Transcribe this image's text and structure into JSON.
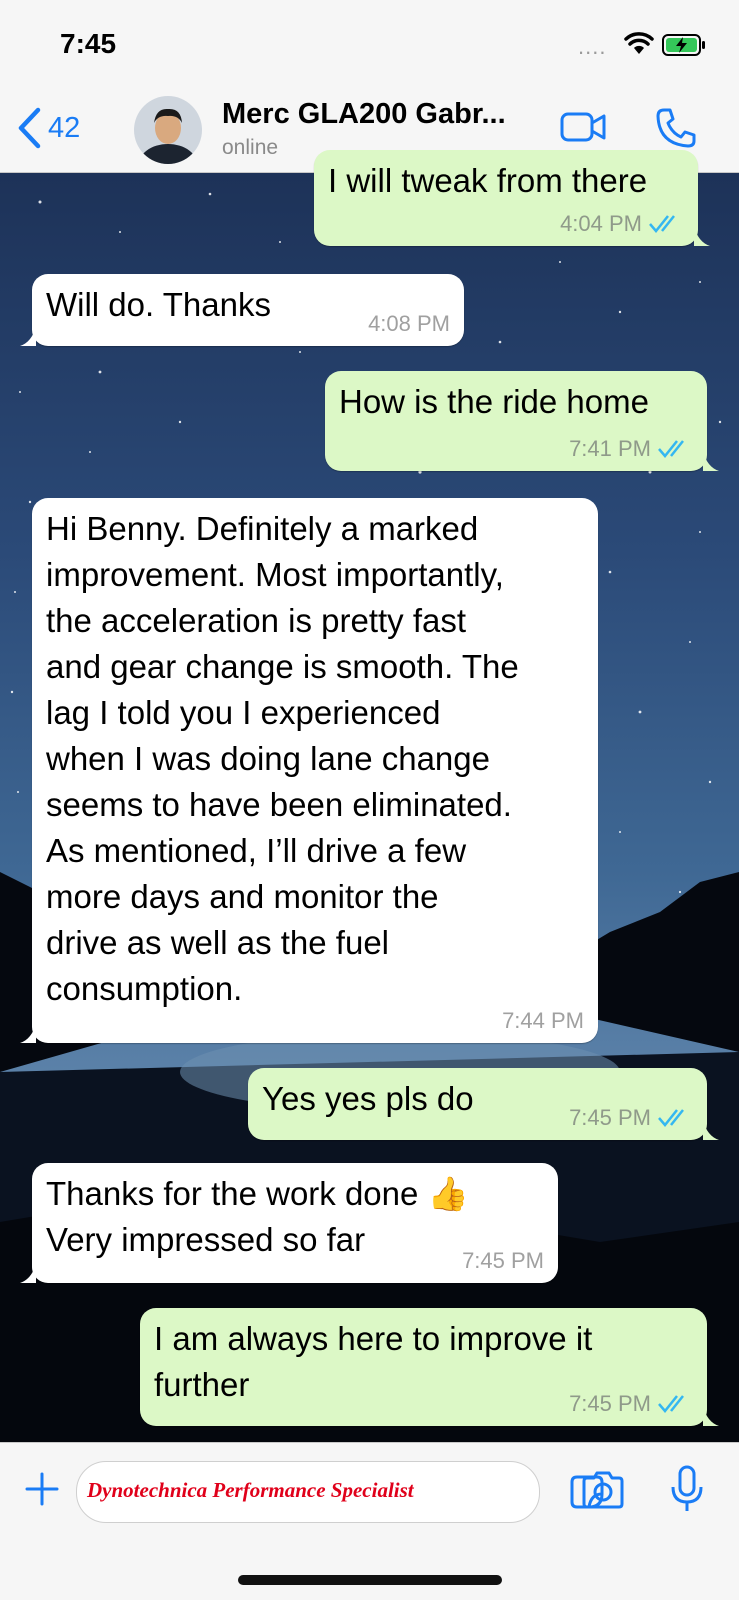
{
  "status_bar": {
    "time": "7:45",
    "signal": "....",
    "icons": [
      "wifi-icon",
      "battery-charging-icon"
    ]
  },
  "header": {
    "back_icon": "chevron-left-icon",
    "back_count": "42",
    "contact_name": "Merc GLA200 Gabr...",
    "contact_status": "online",
    "actions": [
      "video-call-icon",
      "phone-icon"
    ]
  },
  "messages": [
    {
      "direction": "outgoing",
      "text_lines": [
        "I will tweak from there"
      ],
      "time": "4:04 PM",
      "read": true
    },
    {
      "direction": "incoming",
      "text_lines": [
        "Will do. Thanks"
      ],
      "time": "4:08 PM"
    },
    {
      "direction": "outgoing",
      "text_lines": [
        "How is the ride home"
      ],
      "time": "7:41 PM",
      "read": true
    },
    {
      "direction": "incoming",
      "text_lines": [
        "Hi Benny. Definitely a marked",
        "improvement. Most importantly,",
        "the acceleration is pretty fast",
        "and gear change is smooth. The",
        "lag I told you I experienced",
        "when I was doing lane change",
        "seems to have been eliminated.",
        "As mentioned, I’ll drive a few",
        "more days and monitor the",
        "drive as well as the fuel",
        "consumption."
      ],
      "time": "7:44 PM"
    },
    {
      "direction": "outgoing",
      "text_lines": [
        "Yes yes pls do"
      ],
      "time": "7:45 PM",
      "read": true
    },
    {
      "direction": "incoming",
      "text_lines": [
        "Thanks for the work done 👍",
        "Very impressed so far"
      ],
      "time": "7:45 PM"
    },
    {
      "direction": "outgoing",
      "text_lines": [
        "I am always here to improve it",
        "further"
      ],
      "time": "7:45 PM",
      "read": true
    }
  ],
  "input_bar": {
    "text": "Dynotechnica Performance Specialist",
    "text_color": "#e0001a",
    "icons": [
      "plus-icon",
      "sticker-icon",
      "camera-icon",
      "microphone-icon"
    ]
  },
  "colors": {
    "accent": "#1a7cf5",
    "outgoing_bubble": "#dcf8c6",
    "incoming_bubble": "#ffffff",
    "read_ticks": "#34b7f1"
  }
}
